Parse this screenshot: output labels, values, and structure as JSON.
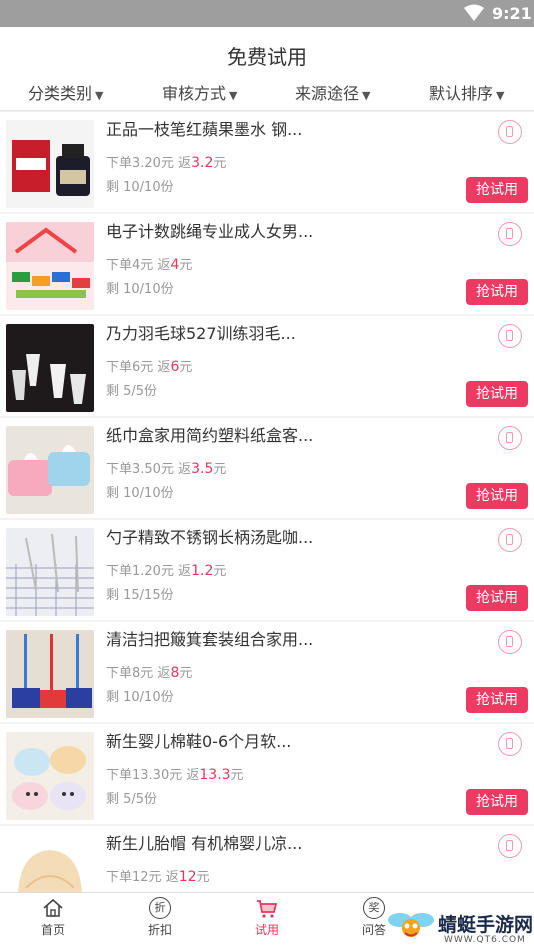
{
  "status": {
    "time": "9:21"
  },
  "header": {
    "title": "免费试用"
  },
  "filters": [
    "分类类别",
    "审核方式",
    "来源途径",
    "默认排序"
  ],
  "items": [
    {
      "name": "正品一枝笔红蘋果墨水 钢...",
      "price_label": "下单3.20元",
      "rebate_prefix": "返",
      "rebate_value": "3.2",
      "rebate_unit": "元",
      "stock": "剩 10/10份",
      "button": "抢试用"
    },
    {
      "name": "电子计数跳绳专业成人女男...",
      "price_label": "下单4元",
      "rebate_prefix": "返",
      "rebate_value": "4",
      "rebate_unit": "元",
      "stock": "剩 10/10份",
      "button": "抢试用"
    },
    {
      "name": "乃力羽毛球527训练羽毛...",
      "price_label": "下单6元",
      "rebate_prefix": "返",
      "rebate_value": "6",
      "rebate_unit": "元",
      "stock": "剩 5/5份",
      "button": "抢试用"
    },
    {
      "name": "纸巾盒家用简约塑料纸盒客...",
      "price_label": "下单3.50元",
      "rebate_prefix": "返",
      "rebate_value": "3.5",
      "rebate_unit": "元",
      "stock": "剩 10/10份",
      "button": "抢试用"
    },
    {
      "name": "勺子精致不锈钢长柄汤匙咖...",
      "price_label": "下单1.20元",
      "rebate_prefix": "返",
      "rebate_value": "1.2",
      "rebate_unit": "元",
      "stock": "剩 15/15份",
      "button": "抢试用"
    },
    {
      "name": "清洁扫把簸箕套装组合家用...",
      "price_label": "下单8元",
      "rebate_prefix": "返",
      "rebate_value": "8",
      "rebate_unit": "元",
      "stock": "剩 10/10份",
      "button": "抢试用"
    },
    {
      "name": "新生婴儿棉鞋0-6个月软...",
      "price_label": "下单13.30元",
      "rebate_prefix": "返",
      "rebate_value": "13.3",
      "rebate_unit": "元",
      "stock": "剩 5/5份",
      "button": "抢试用"
    },
    {
      "name": "新生儿胎帽 有机棉婴儿凉...",
      "price_label": "下单12元",
      "rebate_prefix": "返",
      "rebate_value": "12",
      "rebate_unit": "元",
      "stock": "",
      "button": ""
    }
  ],
  "tabs": [
    {
      "label": "首页",
      "icon": "home-icon"
    },
    {
      "label": "折扣",
      "icon": "discount-icon",
      "glyph": "折"
    },
    {
      "label": "试用",
      "icon": "cart-icon",
      "active": true
    },
    {
      "label": "问答",
      "icon": "reward-icon",
      "glyph": "奖"
    }
  ],
  "watermark": {
    "name": "蜻蜓手游网",
    "url": "WWW.QT6.COM"
  },
  "colors": {
    "accent": "#ec3a63",
    "status_bar": "#9e9e9e"
  }
}
